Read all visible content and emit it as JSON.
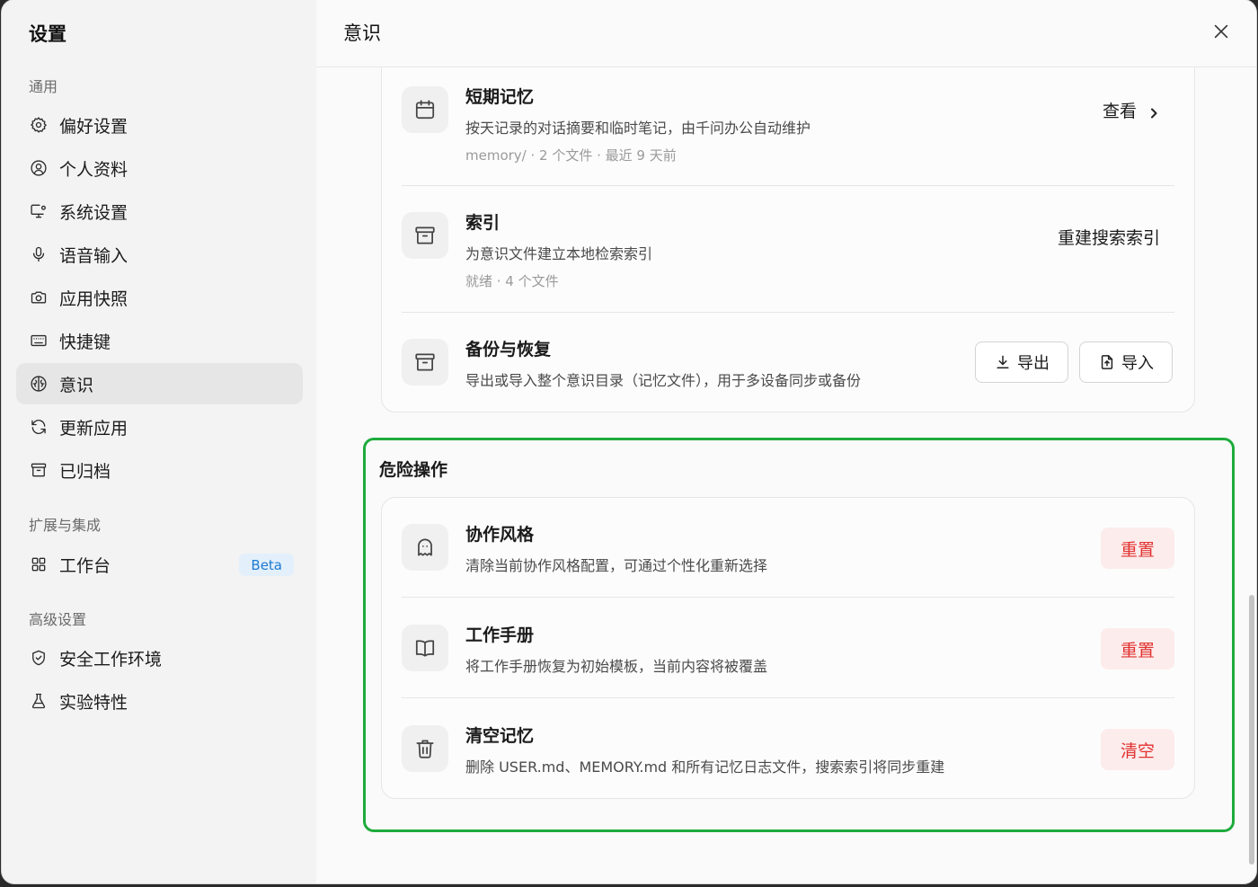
{
  "sidebar": {
    "title": "设置",
    "sections": {
      "general": "通用",
      "extensions": "扩展与集成",
      "advanced": "高级设置"
    },
    "items": {
      "preferences": "偏好设置",
      "profile": "个人资料",
      "system": "系统设置",
      "voice": "语音输入",
      "snapshot": "应用快照",
      "shortcuts": "快捷键",
      "consciousness": "意识",
      "update": "更新应用",
      "archived": "已归档",
      "workbench": "工作台",
      "workbench_badge": "Beta",
      "secure_env": "安全工作环境",
      "experimental": "实验特性"
    }
  },
  "main": {
    "title": "意识",
    "memory_card": {
      "short_term": {
        "title": "短期记忆",
        "desc": "按天记录的对话摘要和临时笔记，由千问办公自动维护",
        "meta": "memory/ · 2 个文件 · 最近 9 天前",
        "action": "查看"
      },
      "index": {
        "title": "索引",
        "desc": "为意识文件建立本地检索索引",
        "meta": "就绪 · 4 个文件",
        "action": "重建搜索索引"
      },
      "backup": {
        "title": "备份与恢复",
        "desc": "导出或导入整个意识目录（记忆文件），用于多设备同步或备份",
        "export": "导出",
        "import": "导入"
      }
    },
    "danger": {
      "title": "危险操作",
      "style": {
        "title": "协作风格",
        "desc": "清除当前协作风格配置，可通过个性化重新选择",
        "action": "重置"
      },
      "handbook": {
        "title": "工作手册",
        "desc": "将工作手册恢复为初始模板，当前内容将被覆盖",
        "action": "重置"
      },
      "clear": {
        "title": "清空记忆",
        "desc": "删除 USER.md、MEMORY.md 和所有记忆日志文件，搜索索引将同步重建",
        "action": "清空"
      }
    }
  },
  "colors": {
    "danger_text": "#e0312f",
    "danger_bg": "#fdecec",
    "highlight_frame": "#1eab3c",
    "badge_text": "#1d7ad0",
    "badge_bg": "#e3f0fb"
  }
}
